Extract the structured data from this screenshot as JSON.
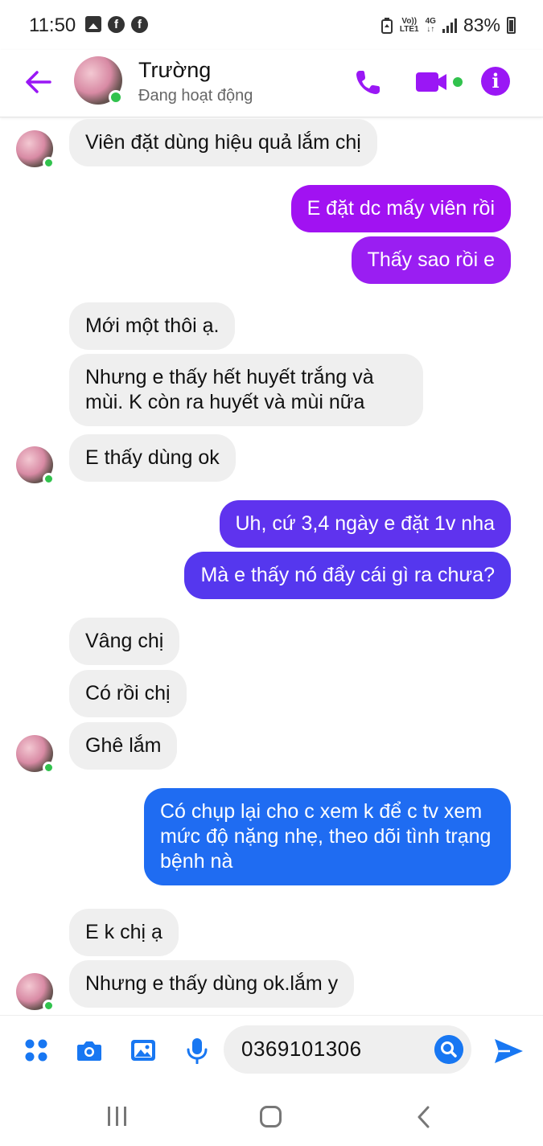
{
  "status_bar": {
    "time": "11:50",
    "network_top": "Vo))",
    "network_bottom": "LTE1",
    "data_top": "4G",
    "data_bottom": "↓↑",
    "battery": "83%",
    "battery_level_fraction": 0.83
  },
  "header": {
    "contact_name": "Trường",
    "contact_status": "Đang hoạt động",
    "info_glyph": "i",
    "accent_color": "#9a17f5",
    "online_color": "#31c24d"
  },
  "messages": [
    {
      "direction": "in",
      "text": "Viên đặt dùng hiệu quả lắm chị"
    },
    {
      "direction": "out",
      "text": "E đặt dc mấy viên rồi"
    },
    {
      "direction": "out",
      "text": "Thấy sao rồi e"
    },
    {
      "direction": "in",
      "text": "Mới một thôi ạ."
    },
    {
      "direction": "in",
      "text": "Nhưng e thấy hết huyết trắng và mùi. K còn ra huyết và mùi nữa"
    },
    {
      "direction": "in",
      "text": "E thấy dùng ok"
    },
    {
      "direction": "out",
      "text": "Uh, cứ 3,4 ngày e đặt 1v nha"
    },
    {
      "direction": "out",
      "text": "Mà e thấy nó đẩy cái gì ra chưa?"
    },
    {
      "direction": "in",
      "text": "Vâng chị"
    },
    {
      "direction": "in",
      "text": "Có rồi chị"
    },
    {
      "direction": "in",
      "text": "Ghê lắm"
    },
    {
      "direction": "out",
      "text": "Có chụp lại cho c xem k  để c tv xem mức độ nặng nhẹ, theo dõi tình trạng bệnh nà"
    },
    {
      "direction": "in",
      "text": "E k chị ạ"
    },
    {
      "direction": "in",
      "text": "Nhưng e thấy dùng ok.lắm y"
    }
  ],
  "bubble_colors": {
    "out_purple": "#a112f2",
    "out_violet": "#7b2cf0",
    "out_indigo": "#5537ee",
    "out_blue": "#1f6cf2",
    "in_gray": "#efefef"
  },
  "composer": {
    "input_value": "0369101306",
    "icons": [
      "apps-grid-icon",
      "camera-icon",
      "gallery-icon",
      "microphone-icon",
      "search-icon",
      "send-icon"
    ],
    "icon_color": "#1877f2"
  },
  "navbar": {
    "icons": [
      "recent-apps-icon",
      "home-icon",
      "back-icon"
    ]
  }
}
